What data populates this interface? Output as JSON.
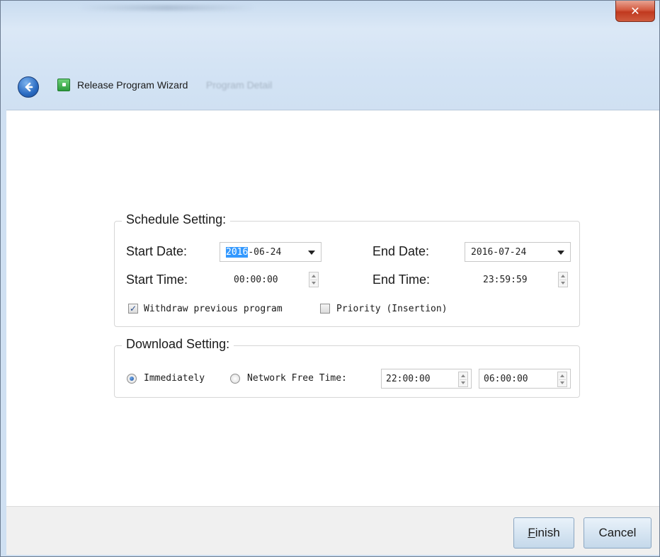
{
  "window": {
    "close_glyph": "✕",
    "ghost_title": "Program Detail"
  },
  "header": {
    "title": "Release Program Wizard",
    "back_icon": "back-arrow-icon",
    "app_icon": "app-icon"
  },
  "schedule": {
    "group_title": "Schedule Setting:",
    "start_date_label": "Start Date:",
    "start_date_selected": "2016",
    "start_date_rest": "-06-24",
    "end_date_label": "End Date:",
    "end_date": "2016-07-24",
    "start_time_label": "Start Time:",
    "start_time": "00:00:00",
    "end_time_label": "End Time:",
    "end_time": "23:59:59",
    "withdraw_label": "Withdraw previous program",
    "withdraw_checked": true,
    "priority_label": "Priority (Insertion)",
    "priority_checked": false
  },
  "download": {
    "group_title": "Download Setting:",
    "immediately_label": "Immediately",
    "immediately_selected": true,
    "network_free_label": "Network Free Time:",
    "free_start": "22:00:00",
    "free_end": "06:00:00"
  },
  "footer": {
    "finish_mnemonic": "F",
    "finish_rest": "inish",
    "cancel_label": "Cancel"
  }
}
